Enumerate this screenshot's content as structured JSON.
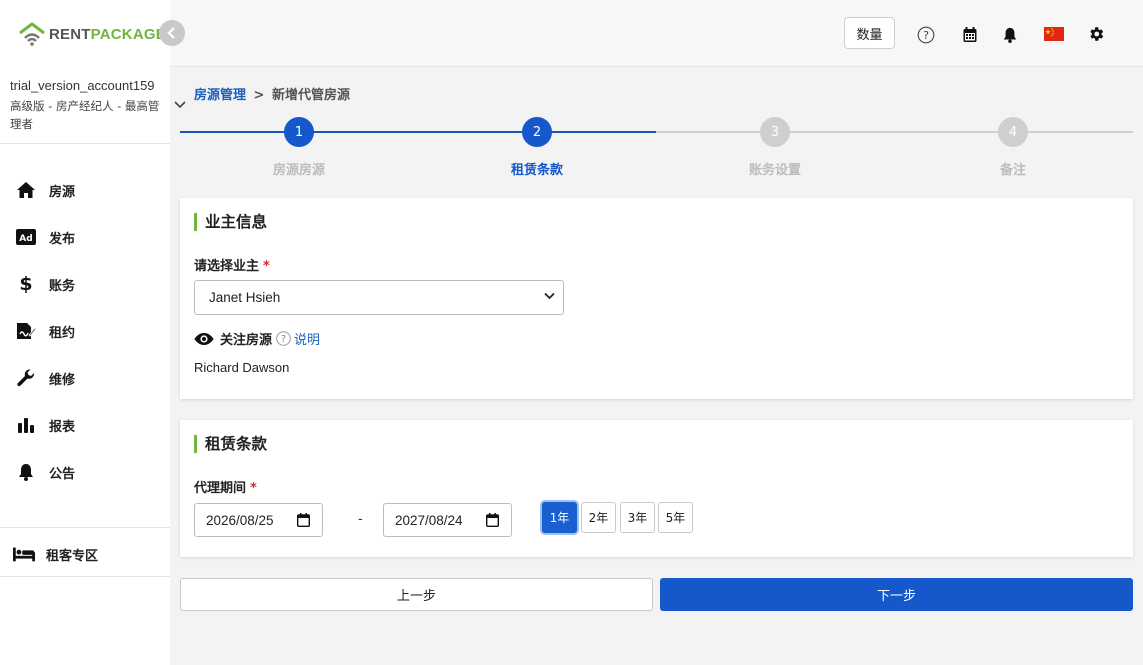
{
  "app": {
    "logo_part1": "RENT",
    "logo_part2": "PACKAGE",
    "brand_color": "#6fb63f",
    "accent_color": "#1558cc"
  },
  "account": {
    "name": "trial_version_account159",
    "role": "高级版 - 房产经纪人 - 最高管理者"
  },
  "sidebar": {
    "items": [
      {
        "label": "房源",
        "icon": "home-icon"
      },
      {
        "label": "发布",
        "icon": "ad-icon"
      },
      {
        "label": "账务",
        "icon": "dollar-icon"
      },
      {
        "label": "租约",
        "icon": "contract-icon"
      },
      {
        "label": "维修",
        "icon": "wrench-icon"
      },
      {
        "label": "报表",
        "icon": "bar-chart-icon"
      },
      {
        "label": "公告",
        "icon": "bell-icon"
      }
    ],
    "tenant_area": {
      "label": "租客专区",
      "icon": "bed-icon"
    }
  },
  "topbar": {
    "qty_label": "数量",
    "icons": [
      "help-icon",
      "calendar-icon",
      "bell-icon",
      "china-flag-icon",
      "gear-icon"
    ]
  },
  "breadcrumb": {
    "parent": "房源管理",
    "separator": ">",
    "current": "新增代管房源"
  },
  "stepper": {
    "current_step": 2,
    "steps": [
      {
        "num": "1",
        "label": "房源房源"
      },
      {
        "num": "2",
        "label": "租赁条款"
      },
      {
        "num": "3",
        "label": "账务设置"
      },
      {
        "num": "4",
        "label": "备注"
      }
    ]
  },
  "owner_card": {
    "title": "业主信息",
    "select_label": "请选择业主",
    "required_mark": "*",
    "selected_owner": "Janet Hsieh",
    "watch_label": "关注房源",
    "explain_link": "说明",
    "watcher_name": "Richard Dawson"
  },
  "lease_card": {
    "title": "租赁条款",
    "period_label": "代理期间",
    "required_mark": "*",
    "start_date": "2026/08/25",
    "date_separator": "-",
    "end_date": "2027/08/24",
    "year_options": [
      "1年",
      "2年",
      "3年",
      "5年"
    ],
    "selected_year": "1年"
  },
  "buttons": {
    "prev": "上一步",
    "next": "下一步"
  }
}
